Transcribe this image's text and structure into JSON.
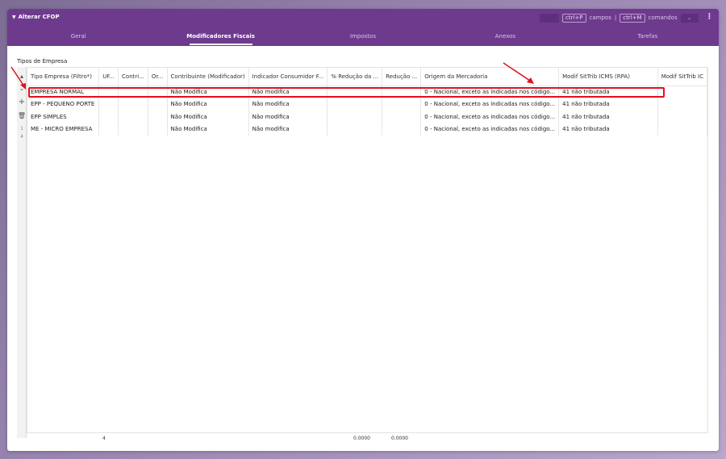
{
  "window": {
    "title": "Alterar CFOP",
    "shortcut_fields_key": "ctrl+P",
    "shortcut_fields_label": "campos",
    "separator": "|",
    "shortcut_commands_key": "ctrl+M",
    "shortcut_commands_label": "comandos"
  },
  "tabs": [
    {
      "label": "Geral",
      "active": false
    },
    {
      "label": "Modificadores Fiscais",
      "active": true
    },
    {
      "label": "Impostos",
      "active": false
    },
    {
      "label": "Anexos",
      "active": false
    },
    {
      "label": "Tarefas",
      "active": false
    }
  ],
  "section": {
    "title": "Tipos de Empresa"
  },
  "grid": {
    "columns": [
      "Tipo Empresa (Filtro*)",
      "UF...",
      "Contri...",
      "Or...",
      "Contribuinte (Modificador)",
      "Indicador Consumidor F...",
      "% Redução da ...",
      "Redução ...",
      "Origem da Mercadoria",
      "Modif SitTrib ICMS (RPA)",
      "Modif SitTrib IC"
    ],
    "rows": [
      [
        "EMPRESA NORMAL",
        "",
        "",
        "",
        "Não Modifica",
        "Não modifica",
        "",
        "",
        "0 - Nacional, exceto as indicadas nos código...",
        "41 não tributada",
        ""
      ],
      [
        "EPP - PEQUENO PORTE",
        "",
        "",
        "",
        "Não Modifica",
        "Não modifica",
        "",
        "",
        "0 - Nacional, exceto as indicadas nos código...",
        "41 não tributada",
        ""
      ],
      [
        "EPP SIMPLES",
        "",
        "",
        "",
        "Não Modifica",
        "Não modifica",
        "",
        "",
        "0 - Nacional, exceto as indicadas nos código...",
        "41 não tributada",
        ""
      ],
      [
        "ME - MICRO EMPRESA",
        "",
        "",
        "",
        "Não Modifica",
        "Não modifica",
        "",
        "",
        "0 - Nacional, exceto as indicadas nos código...",
        "41 não tributada",
        ""
      ]
    ],
    "footer": {
      "count": "4",
      "sum_reducao_pct": "0.0000",
      "sum_reducao": "0.0000"
    },
    "side_counters": [
      "1",
      "4"
    ]
  },
  "icons": {
    "collapse": "caret-down-icon",
    "kebab": "more-vertical-icon",
    "add": "plus-icon",
    "delete": "trash-icon",
    "dropdown": "chevron-down-icon"
  },
  "colors": {
    "header_purple": "#6e3a8e",
    "highlight_red": "#e0101a"
  }
}
